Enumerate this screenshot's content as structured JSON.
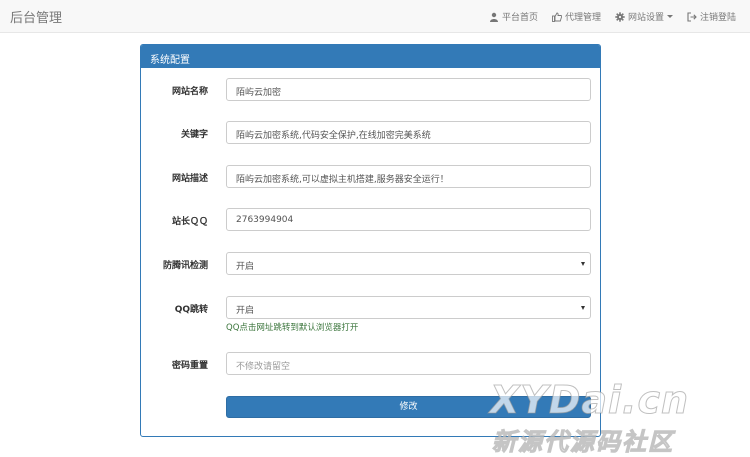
{
  "navbar": {
    "brand": "后台管理",
    "items": [
      {
        "label": "平台首页",
        "icon": "user-icon"
      },
      {
        "label": "代理管理",
        "icon": "thumbs-up-icon"
      },
      {
        "label": "网站设置",
        "icon": "gear-icon",
        "dropdown": true
      },
      {
        "label": "注销登陆",
        "icon": "logout-icon"
      }
    ]
  },
  "panel": {
    "title": "系统配置",
    "fields": [
      {
        "label": "网站名称",
        "value": "陌屿云加密",
        "type": "text"
      },
      {
        "label": "关键字",
        "value": "陌屿云加密系统,代码安全保护,在线加密完美系统",
        "type": "text"
      },
      {
        "label": "网站描述",
        "value": "陌屿云加密系统,可以虚拟主机搭建,服务器安全运行！",
        "type": "text"
      },
      {
        "label": "站长ＱＱ",
        "value": "2763994904",
        "type": "text"
      },
      {
        "label": "防腾讯检测",
        "value": "开启",
        "type": "select"
      },
      {
        "label": "QQ跳转",
        "value": "开启",
        "type": "select",
        "help": "QQ点击网址跳转到默认浏览器打开"
      },
      {
        "label": "密码重置",
        "placeholder": "不修改请留空",
        "type": "password"
      }
    ],
    "submit_label": "修改"
  },
  "watermark": {
    "line1": "XYDai.cn",
    "line2": "新源代源码社区"
  },
  "colors": {
    "primary": "#337ab7",
    "navbar_bg": "#f8f8f8",
    "help_text": "#3c763d"
  }
}
